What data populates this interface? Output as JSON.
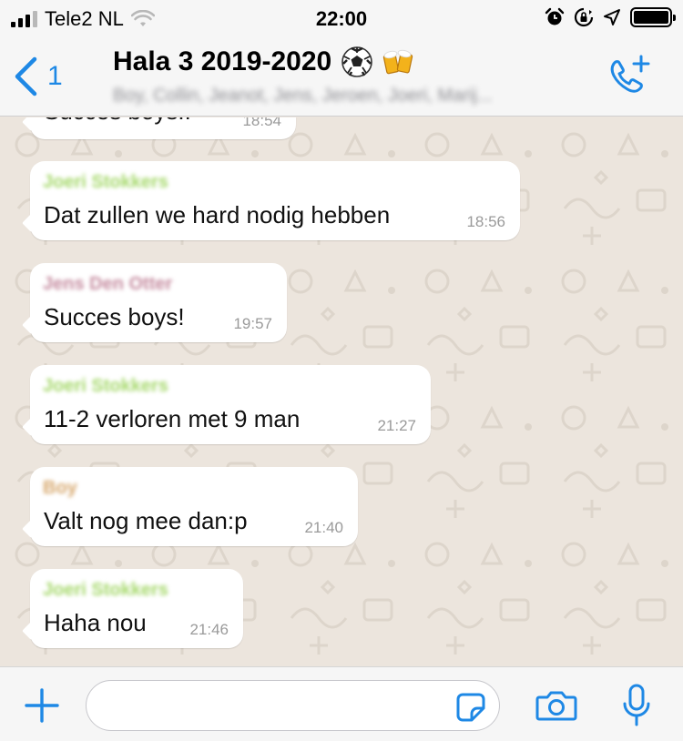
{
  "status_bar": {
    "carrier": "Tele2 NL",
    "time": "22:00",
    "icons": [
      "signal-icon",
      "wifi-icon",
      "alarm-icon",
      "rotation-lock-icon",
      "location-icon",
      "battery-icon"
    ]
  },
  "header": {
    "back_count": "1",
    "title": "Hala 3 2019-2020",
    "title_emojis": [
      "soccer-ball-emoji",
      "beer-mugs-emoji"
    ],
    "participants": "Boy, Collin, Jeanot, Jens, Jeroen, Joeri, Marij..."
  },
  "messages": [
    {
      "sender": "",
      "text": "Succes boys!!",
      "time": "18:54"
    },
    {
      "sender": "Joeri Stokkers",
      "sender_color": "#a5d86a",
      "text": "Dat zullen we hard nodig hebben",
      "time": "18:56"
    },
    {
      "sender": "Jens Den Otter",
      "sender_color": "#c58b9f",
      "text": "Succes boys!",
      "time": "19:57"
    },
    {
      "sender": "Joeri Stokkers",
      "sender_color": "#a5d86a",
      "text": "11-2 verloren met 9 man",
      "time": "21:27"
    },
    {
      "sender": "Boy",
      "sender_color": "#d7a86e",
      "text": "Valt nog mee dan:p",
      "time": "21:40"
    },
    {
      "sender": "Joeri Stokkers",
      "sender_color": "#a5d86a",
      "text": "Haha nou",
      "time": "21:46"
    }
  ],
  "composer": {
    "placeholder": ""
  },
  "colors": {
    "accent": "#1e88e5",
    "chat_background": "#ece5dd",
    "bubble": "#ffffff",
    "timestamp": "#9a9a9a"
  }
}
